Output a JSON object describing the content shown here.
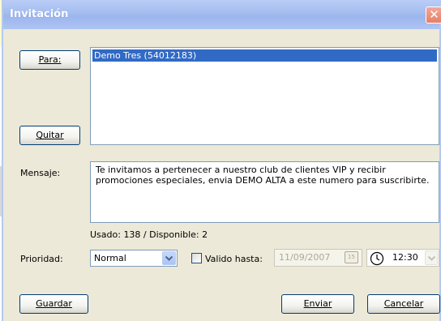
{
  "window": {
    "title": "Invitación"
  },
  "recipients": {
    "button_label": "Para:",
    "remove_label": "Quitar",
    "items": [
      "Demo Tres (54012183)"
    ]
  },
  "message": {
    "label": "Mensaje:",
    "text": "Te invitamos a pertenecer a nuestro club de clientes VIP y recibir promociones especiales, envia DEMO ALTA a este numero para suscribirte.",
    "usage": "Usado: 138 / Disponible: 2"
  },
  "priority": {
    "label": "Prioridad:",
    "selected": "Normal"
  },
  "valid_until": {
    "label": "Valido hasta:",
    "checked": false,
    "date": "11/09/2007",
    "time": "12:30"
  },
  "buttons": {
    "save": "Guardar",
    "send": "Enviar",
    "cancel": "Cancelar"
  },
  "icons": {
    "close": "close-icon",
    "calendar": "calendar-icon",
    "clock": "clock-icon",
    "dropdown": "chevron-down-icon"
  },
  "colors": {
    "titlebar": "#a4bdf0",
    "selection": "#316ac5",
    "dialog_bg": "#ece9d8",
    "close": "#e48068"
  }
}
